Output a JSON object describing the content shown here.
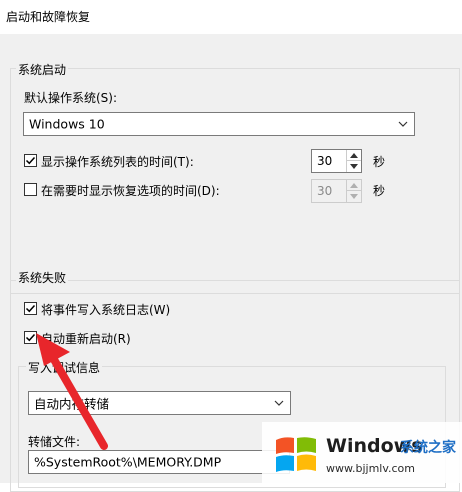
{
  "window": {
    "title": "启动和故障恢复"
  },
  "startup": {
    "group_title": "系统启动",
    "default_os_label": "默认操作系统(S):",
    "default_os_value": "Windows 10",
    "show_list": {
      "label": "显示操作系统列表的时间(T):",
      "checked": true,
      "value": "30",
      "unit": "秒"
    },
    "show_recovery": {
      "label": "在需要时显示恢复选项的时间(D):",
      "checked": false,
      "value": "30",
      "unit": "秒"
    }
  },
  "failure": {
    "group_title": "系统失败",
    "write_event": {
      "label": "将事件写入系统日志(W)",
      "checked": true
    },
    "auto_restart": {
      "label": "自动重新启动(R)",
      "checked": true
    },
    "debug_group_title": "写入调试信息",
    "debug_type_value": "自动内存转储",
    "dump_file_label": "转储文件:",
    "dump_file_value": "%SystemRoot%\\MEMORY.DMP"
  },
  "watermark": {
    "brand": "Windows",
    "brand_cn": "系统之家",
    "url": "www.bjjmlv.com"
  },
  "colors": {
    "arrow": "#e8262b",
    "logo_red": "#f35325",
    "logo_green": "#81bc06",
    "logo_blue": "#05a6f0",
    "logo_yellow": "#ffba08"
  },
  "icons": {
    "dropdown": "chevron-down-icon",
    "spin_up": "spin-up-icon",
    "spin_down": "spin-down-icon",
    "check": "check-icon"
  }
}
